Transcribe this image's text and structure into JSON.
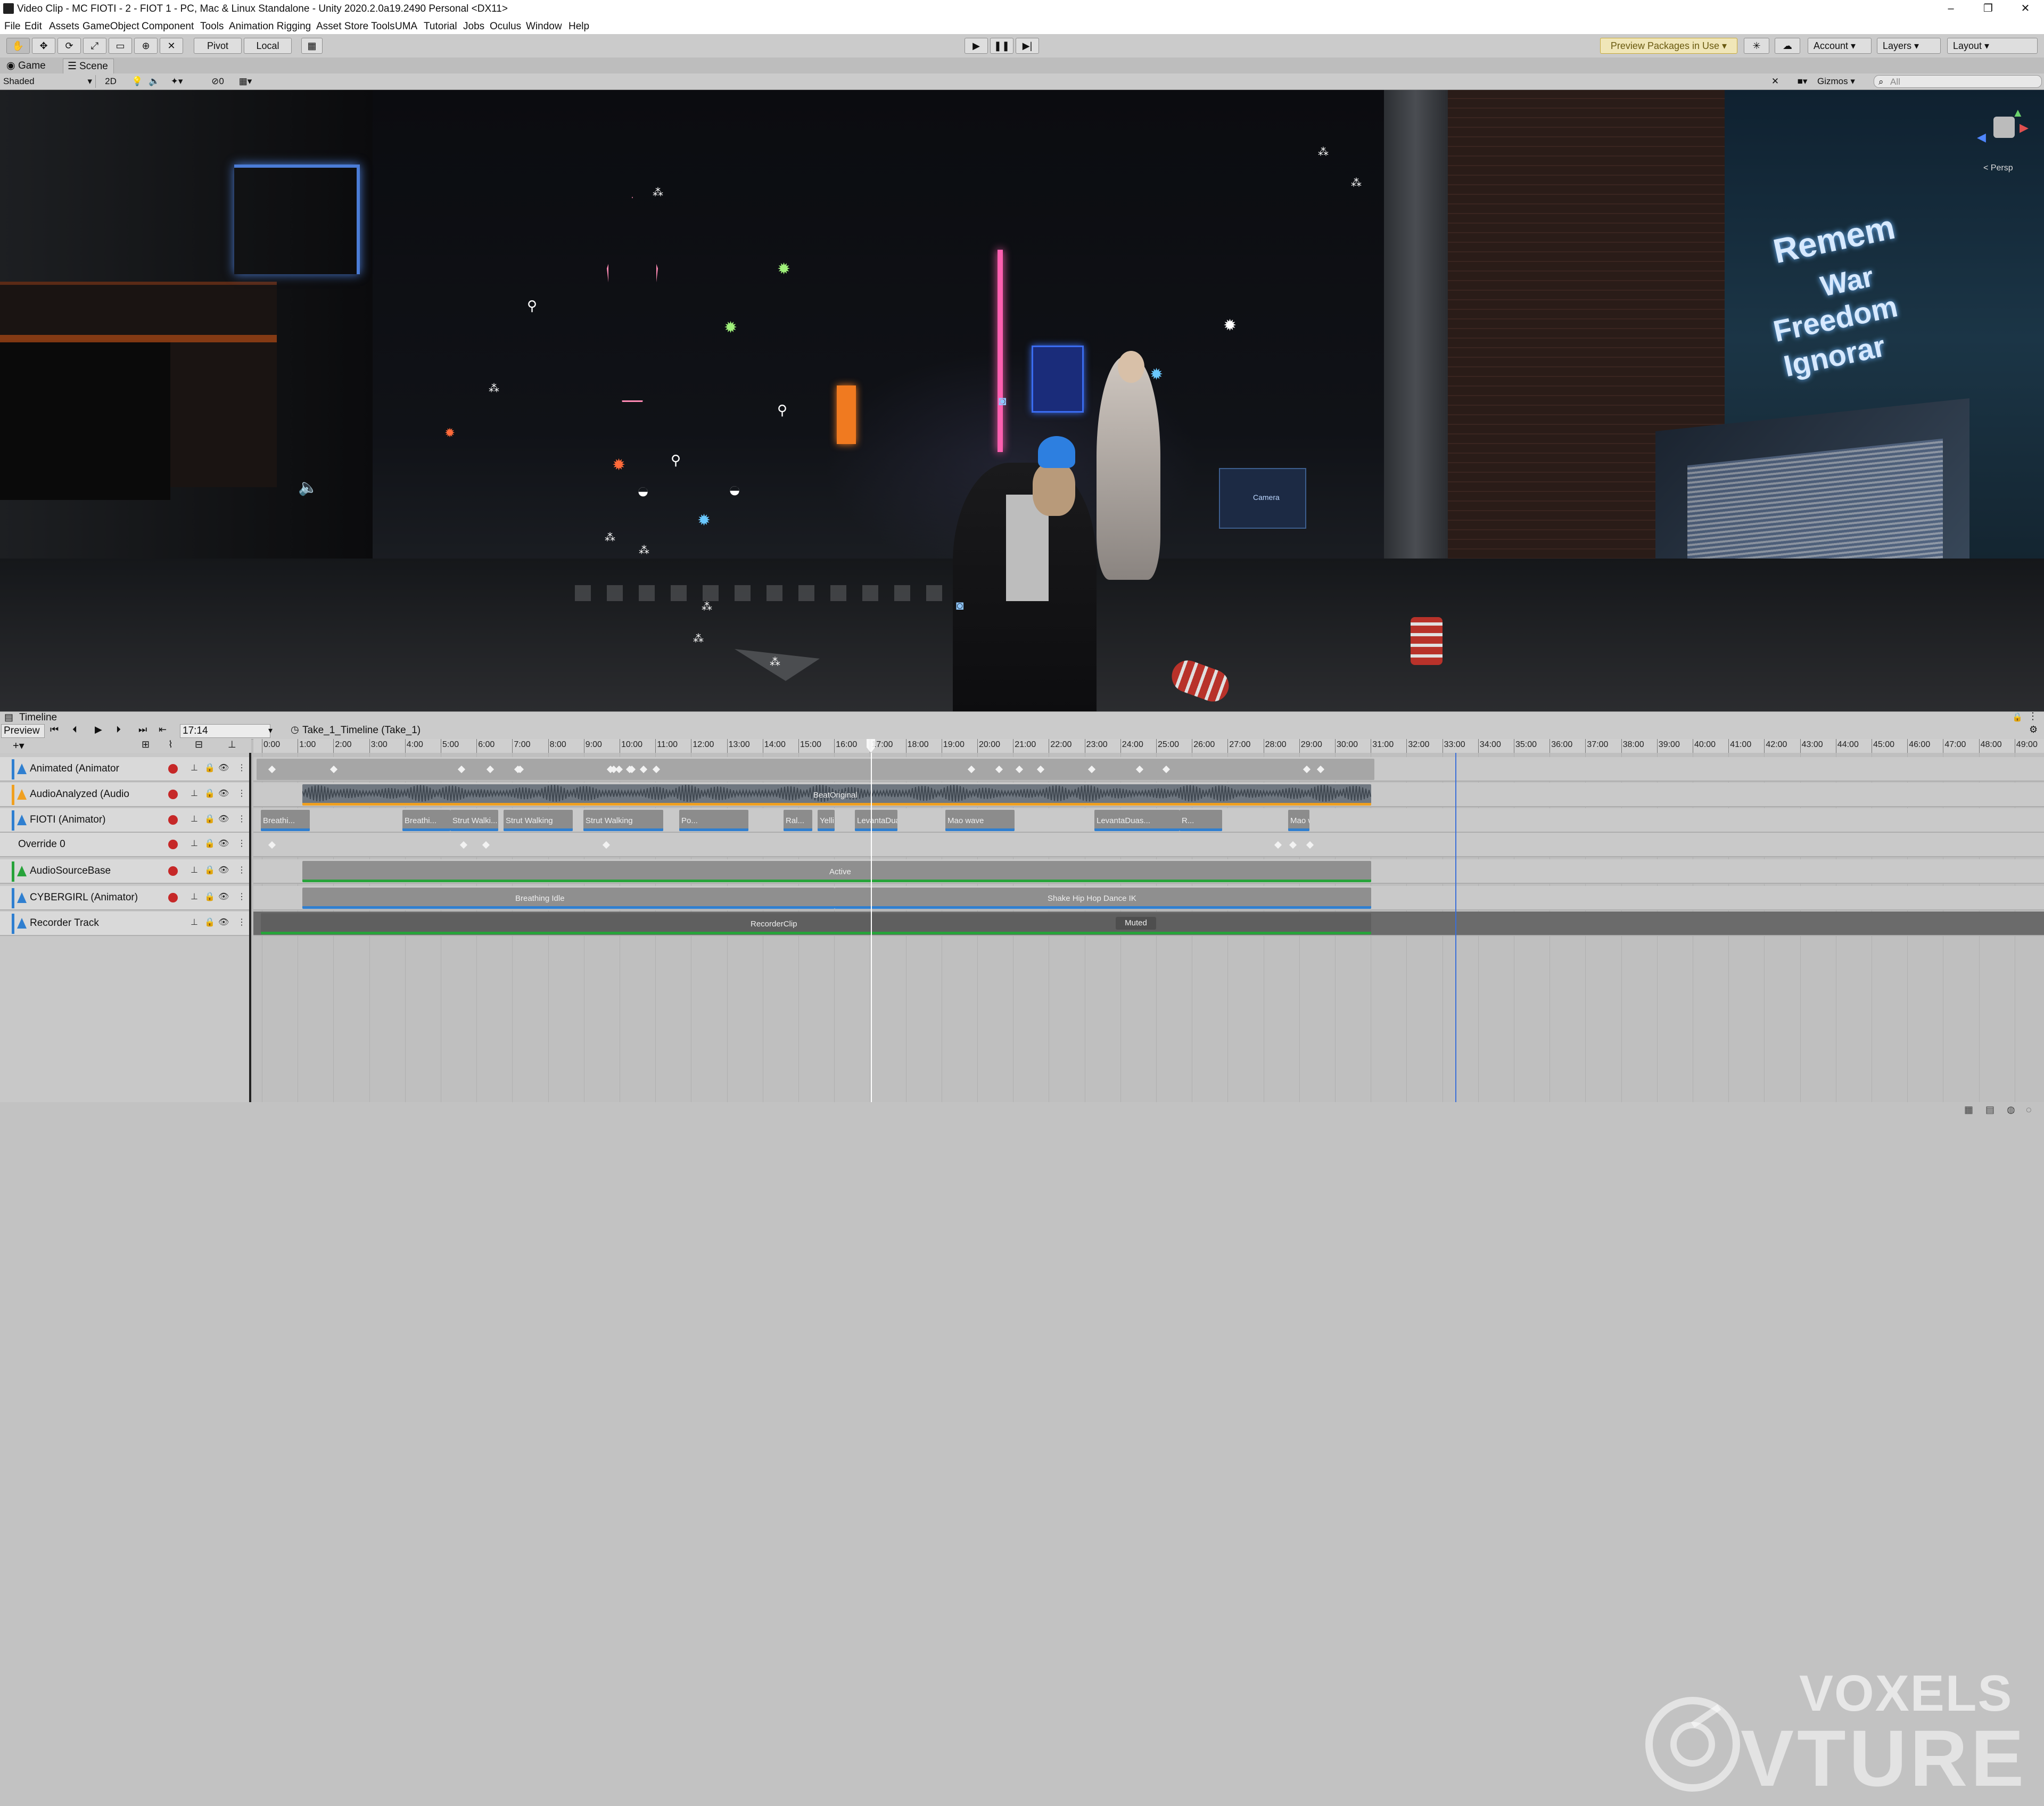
{
  "window": {
    "title": "Video Clip - MC FIOTI - 2 - FIOT 1 - PC, Mac & Linux Standalone - Unity 2020.2.0a19.2490 Personal <DX11>",
    "controls": {
      "minimize": "–",
      "maximize": "❐",
      "close": "✕"
    }
  },
  "menu": [
    "File",
    "Edit",
    "Assets",
    "GameObject",
    "Component",
    "Tools",
    "Animation Rigging",
    "Asset Store Tools",
    "UMA",
    "Tutorial",
    "Jobs",
    "Oculus",
    "Window",
    "Help"
  ],
  "toolbar": {
    "pivot": "Pivot",
    "local": "Local",
    "preview_packages": "Preview Packages in Use ▾",
    "account": "Account",
    "layers": "Layers",
    "layout": "Layout"
  },
  "tabs": {
    "game": "Game",
    "scene": "Scene"
  },
  "scene_toolbar": {
    "shading": "Shaded",
    "mode_2d": "2D",
    "hidden_count": "0",
    "gizmos": "Gizmos",
    "search_placeholder": "All",
    "persp_label": "< Persp"
  },
  "scene": {
    "sign_lines": [
      "Remem",
      "War",
      "Freedom",
      "Ignorar"
    ],
    "camera_label": "Camera"
  },
  "timeline": {
    "panel_title": "Timeline",
    "preview_label": "Preview",
    "current_time": "17:14",
    "breadcrumb": "Take_1_Timeline (Take_1)",
    "ruler_ticks": [
      "0:00",
      "1:00",
      "2:00",
      "3:00",
      "4:00",
      "5:00",
      "6:00",
      "7:00",
      "8:00",
      "9:00",
      "10:00",
      "11:00",
      "12:00",
      "13:00",
      "14:00",
      "15:00",
      "16:00",
      "17:00",
      "18:00",
      "19:00",
      "20:00",
      "21:00",
      "22:00",
      "23:00",
      "24:00",
      "25:00",
      "26:00",
      "27:00",
      "28:00",
      "29:00",
      "30:00",
      "31:00",
      "32:00",
      "33:00",
      "34:00",
      "35:00",
      "36:00",
      "37:00",
      "38:00",
      "39:00",
      "40:00",
      "41:00",
      "42:00",
      "43:00",
      "44:00",
      "45:00",
      "46:00",
      "47:00",
      "48:00",
      "49:00"
    ],
    "tracks": [
      {
        "name": "Animated (Animator",
        "color": "#2f7fd0"
      },
      {
        "name": "AudioAnalyzed (Audio",
        "color": "#f0a020"
      },
      {
        "name": "FIOTI (Animator)",
        "color": "#2f7fd0"
      },
      {
        "name": "Override 0",
        "color": ""
      },
      {
        "name": "AudioSourceBase",
        "color": "#27a33a"
      },
      {
        "name": "CYBERGIRL (Animator)",
        "color": "#2f7fd0"
      },
      {
        "name": "Recorder Track",
        "color": "#2f7fd0"
      }
    ],
    "clips": {
      "audio": "BeatOriginal",
      "fioti": [
        "Breathi...",
        "Breathi...",
        "Strut Walki...",
        "Strut Walking",
        "Strut Walking",
        "Po...",
        "Ral...",
        "Yelling Out",
        "LevantaDuasMaos",
        "Mao wave",
        "LevantaDuas...",
        "R...",
        "Mao wav..."
      ],
      "activation": "Active",
      "cybergirl": [
        "Breathing Idle",
        "Shake Hip Hop Dance IK"
      ],
      "recorder": "RecorderClip",
      "muted": "Muted"
    },
    "watermark": [
      "VOXELS",
      "VTURE"
    ]
  }
}
